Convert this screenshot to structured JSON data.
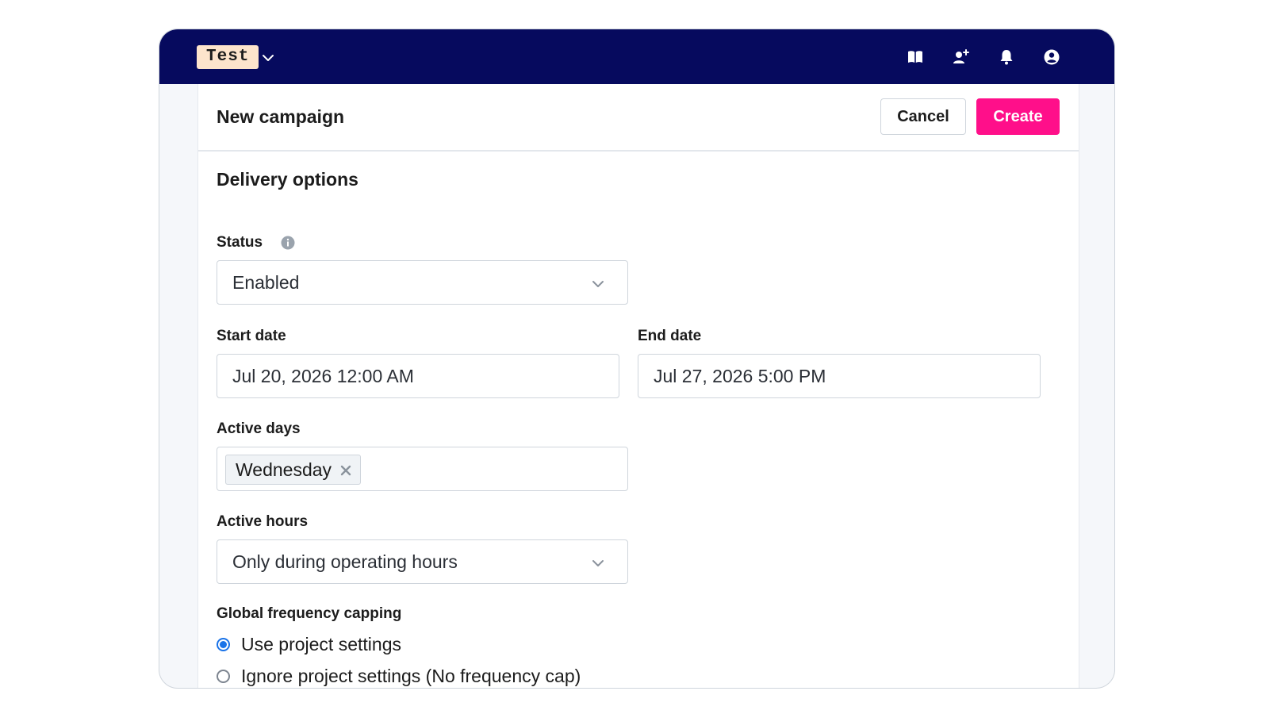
{
  "topbar": {
    "env_label": "Test",
    "icons": [
      "book-icon",
      "add-user-icon",
      "bell-icon",
      "account-icon"
    ],
    "bg_color": "#060a5e"
  },
  "header": {
    "title": "New campaign",
    "cancel_label": "Cancel",
    "create_label": "Create",
    "accent_color": "#ff0f8a"
  },
  "delivery": {
    "section_title": "Delivery options",
    "status_label": "Status",
    "status_value": "Enabled",
    "start_date_label": "Start date",
    "start_date_value": "Jul 20, 2026 12:00 AM",
    "end_date_label": "End date",
    "end_date_value": "Jul 27, 2026 5:00 PM",
    "active_days_label": "Active days",
    "active_days": [
      "Wednesday"
    ],
    "active_hours_label": "Active hours",
    "active_hours_value": "Only during operating hours",
    "frequency_label": "Global frequency capping",
    "frequency_options": [
      {
        "label": "Use project settings",
        "selected": true
      },
      {
        "label": "Ignore project settings (No frequency cap)",
        "selected": false
      }
    ]
  }
}
